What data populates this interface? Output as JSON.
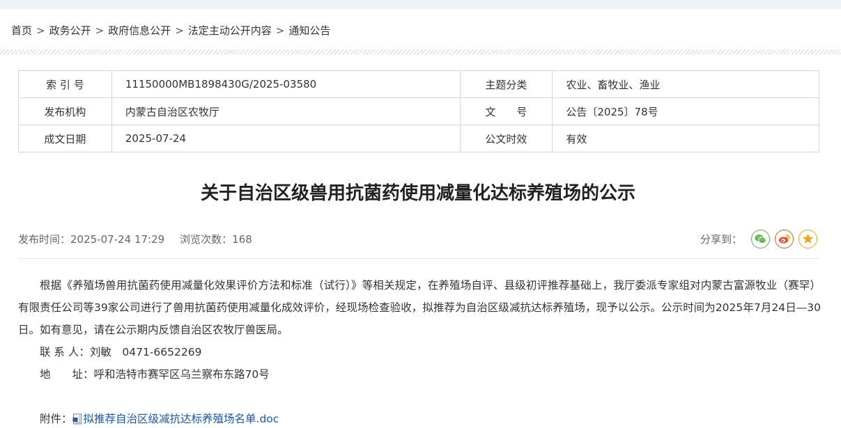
{
  "breadcrumb": {
    "items": [
      "首页",
      "政务公开",
      "政府信息公开",
      "法定主动公开内容",
      "通知公告"
    ],
    "separator": ">"
  },
  "meta": {
    "index_label": "索 引 号",
    "index_value": "11150000MB1898430G/2025-03580",
    "topic_label": "主题分类",
    "topic_value": "农业、畜牧业、渔业",
    "publisher_label": "发布机构",
    "publisher_value": "内蒙古自治区农牧厅",
    "docno_label": "文　　号",
    "docno_value": "公告〔2025〕78号",
    "date_label": "成文日期",
    "date_value": "2025-07-24",
    "validity_label": "公文时效",
    "validity_value": "有效"
  },
  "article": {
    "title": "关于自治区级兽用抗菌药使用减量化达标养殖场的公示",
    "publish_time": "发布时间：2025-07-24 17:29",
    "views": "浏览次数：168",
    "share_label": "分享到：",
    "body": "根据《养殖场兽用抗菌药使用减量化效果评价方法和标准（试行）》等相关规定，在养殖场自评、县级初评推荐基础上，我厅委派专家组对内蒙古富源牧业（赛罕）有限责任公司等39家公司进行了兽用抗菌药使用减量化成效评价，经现场检查验收，拟推荐为自治区级减抗达标养殖场，现予以公示。公示时间为2025年7月24日—30日。如有意见，请在公示期内反馈自治区农牧厅兽医局。",
    "contact": "联 系 人：刘敏　0471-6652269",
    "address": "地　　址：呼和浩特市赛罕区乌兰察布东路70号",
    "attachment_label": "附件：",
    "attachment_name": "拟推荐自治区级减抗达标养殖场名单.doc"
  },
  "icons": {
    "wechat": "wechat-icon",
    "weibo": "weibo-icon",
    "qzone": "star-icon"
  },
  "colors": {
    "wechat": "#5fb54a",
    "weibo": "#e2572d",
    "qzone": "#f0a81a",
    "link": "#1a56b8"
  }
}
